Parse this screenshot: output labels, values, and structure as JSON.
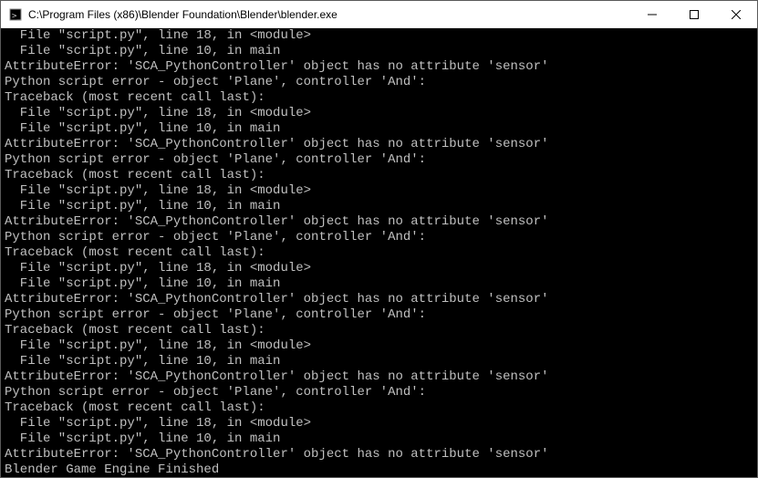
{
  "titlebar": {
    "title": "C:\\Program Files (x86)\\Blender Foundation\\Blender\\blender.exe"
  },
  "console": {
    "lines": [
      "  File \"script.py\", line 18, in <module>",
      "  File \"script.py\", line 10, in main",
      "AttributeError: 'SCA_PythonController' object has no attribute 'sensor'",
      "Python script error - object 'Plane', controller 'And':",
      "Traceback (most recent call last):",
      "  File \"script.py\", line 18, in <module>",
      "  File \"script.py\", line 10, in main",
      "AttributeError: 'SCA_PythonController' object has no attribute 'sensor'",
      "Python script error - object 'Plane', controller 'And':",
      "Traceback (most recent call last):",
      "  File \"script.py\", line 18, in <module>",
      "  File \"script.py\", line 10, in main",
      "AttributeError: 'SCA_PythonController' object has no attribute 'sensor'",
      "Python script error - object 'Plane', controller 'And':",
      "Traceback (most recent call last):",
      "  File \"script.py\", line 18, in <module>",
      "  File \"script.py\", line 10, in main",
      "AttributeError: 'SCA_PythonController' object has no attribute 'sensor'",
      "Python script error - object 'Plane', controller 'And':",
      "Traceback (most recent call last):",
      "  File \"script.py\", line 18, in <module>",
      "  File \"script.py\", line 10, in main",
      "AttributeError: 'SCA_PythonController' object has no attribute 'sensor'",
      "Python script error - object 'Plane', controller 'And':",
      "Traceback (most recent call last):",
      "  File \"script.py\", line 18, in <module>",
      "  File \"script.py\", line 10, in main",
      "AttributeError: 'SCA_PythonController' object has no attribute 'sensor'",
      "Blender Game Engine Finished"
    ]
  }
}
